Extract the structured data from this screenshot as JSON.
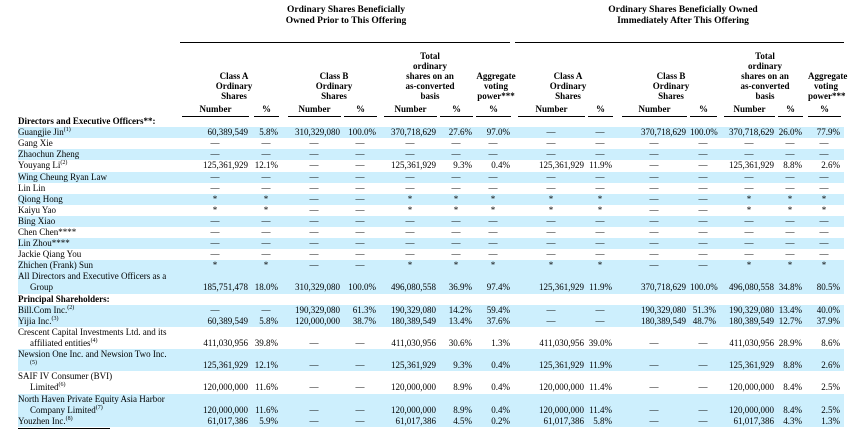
{
  "groups": [
    {
      "line1": "Ordinary Shares Beneficially",
      "line2": "Owned Prior to This Offering"
    },
    {
      "line1": "Ordinary Shares Beneficially Owned",
      "line2": "Immediately After This Offering"
    }
  ],
  "col_headers_prior": [
    {
      "lines": [
        "Class A",
        "Ordinary",
        "Shares"
      ]
    },
    {
      "lines": [
        "Class B",
        "Ordinary",
        "Shares"
      ]
    },
    {
      "lines": [
        "Total",
        "ordinary",
        "shares on an",
        "as-converted",
        "basis"
      ]
    },
    {
      "lines": [
        "Aggregate",
        "voting",
        "power***"
      ]
    }
  ],
  "col_headers_after": [
    {
      "lines": [
        "Class A",
        "Ordinary",
        "Shares"
      ]
    },
    {
      "lines": [
        "Class B",
        "Ordinary",
        "Shares"
      ]
    },
    {
      "lines": [
        "Total",
        "ordinary",
        "shares on an",
        "as-converted",
        "basis"
      ]
    },
    {
      "lines": [
        "Aggregate",
        "voting",
        "power***"
      ]
    }
  ],
  "subheaders": {
    "number": "Number",
    "pct": "%"
  },
  "section1": "Directors and Executive Officers**:",
  "section2": "Principal Shareholders:",
  "rows": [
    {
      "name": "Guangjie Jin",
      "sup": "(1)",
      "shade": true,
      "v": [
        "60,389,549",
        "5.8%",
        "310,329,080",
        "100.0%",
        "370,718,629",
        "27.6%",
        "97.0%",
        "—",
        "—",
        "370,718,629",
        "100.0%",
        "370,718,629",
        "26.0%",
        "77.9%"
      ]
    },
    {
      "name": "Gang Xie",
      "sup": "",
      "shade": false,
      "v": [
        "—",
        "—",
        "—",
        "—",
        "—",
        "—",
        "—",
        "—",
        "—",
        "—",
        "—",
        "—",
        "—",
        "—"
      ]
    },
    {
      "name": "Zhaochun Zheng",
      "sup": "",
      "shade": true,
      "v": [
        "—",
        "—",
        "—",
        "—",
        "—",
        "—",
        "—",
        "—",
        "—",
        "—",
        "—",
        "—",
        "—",
        "—"
      ]
    },
    {
      "name": "Youyang Li",
      "sup": "(2)",
      "shade": false,
      "v": [
        "125,361,929",
        "12.1%",
        "—",
        "—",
        "125,361,929",
        "9.3%",
        "0.4%",
        "125,361,929",
        "11.9%",
        "—",
        "—",
        "125,361,929",
        "8.8%",
        "2.6%"
      ]
    },
    {
      "name": "Wing Cheung Ryan Law",
      "sup": "",
      "shade": true,
      "v": [
        "—",
        "—",
        "—",
        "—",
        "—",
        "—",
        "—",
        "—",
        "—",
        "—",
        "—",
        "—",
        "—",
        "—"
      ]
    },
    {
      "name": "Lin Lin",
      "sup": "",
      "shade": false,
      "v": [
        "—",
        "—",
        "—",
        "—",
        "—",
        "—",
        "—",
        "—",
        "—",
        "—",
        "—",
        "—",
        "—",
        "—"
      ]
    },
    {
      "name": "Qiong Hong",
      "sup": "",
      "shade": true,
      "v": [
        "*",
        "*",
        "—",
        "—",
        "*",
        "*",
        "*",
        "*",
        "*",
        "—",
        "—",
        "*",
        "*",
        "*"
      ]
    },
    {
      "name": "Kaiyu Yao",
      "sup": "",
      "shade": false,
      "v": [
        "*",
        "*",
        "—",
        "—",
        "*",
        "*",
        "*",
        "*",
        "*",
        "—",
        "—",
        "*",
        "*",
        "*"
      ]
    },
    {
      "name": "Bing Xiao",
      "sup": "",
      "shade": true,
      "v": [
        "—",
        "—",
        "—",
        "—",
        "—",
        "—",
        "—",
        "—",
        "—",
        "—",
        "—",
        "—",
        "—",
        "—"
      ]
    },
    {
      "name": "Chen Chen****",
      "sup": "",
      "shade": false,
      "v": [
        "—",
        "—",
        "—",
        "—",
        "—",
        "—",
        "—",
        "—",
        "—",
        "—",
        "—",
        "—",
        "—",
        "—"
      ]
    },
    {
      "name": "Lin Zhou****",
      "sup": "",
      "shade": true,
      "v": [
        "—",
        "—",
        "—",
        "—",
        "—",
        "—",
        "—",
        "—",
        "—",
        "—",
        "—",
        "—",
        "—",
        "—"
      ]
    },
    {
      "name": "Jackie Qiang You",
      "sup": "",
      "shade": false,
      "v": [
        "—",
        "—",
        "—",
        "—",
        "—",
        "—",
        "—",
        "—",
        "—",
        "—",
        "—",
        "—",
        "—",
        "—"
      ]
    },
    {
      "name": "Zhichen (Frank) Sun",
      "sup": "",
      "shade": true,
      "v": [
        "*",
        "*",
        "—",
        "—",
        "*",
        "*",
        "*",
        "*",
        "*",
        "—",
        "—",
        "*",
        "*",
        "*"
      ]
    }
  ],
  "all_group": {
    "line1": "All Directors and Executive Officers as a",
    "line2": "Group",
    "v": [
      "185,751,478",
      "18.0%",
      "310,329,080",
      "100.0%",
      "496,080,558",
      "36.9%",
      "97.4%",
      "125,361,929",
      "11.9%",
      "370,718,629",
      "100.0%",
      "496,080,558",
      "34.8%",
      "80.5%"
    ]
  },
  "principal": [
    {
      "lines": [
        "Bill.Com Inc."
      ],
      "sup": "(2)",
      "shade": true,
      "v": [
        "—",
        "—",
        "190,329,080",
        "61.3%",
        "190,329,080",
        "14.2%",
        "59.4%",
        "—",
        "—",
        "190,329,080",
        "51.3%",
        "190,329,080",
        "13.4%",
        "40.0%"
      ]
    },
    {
      "lines": [
        "Yijia Inc."
      ],
      "sup": "(3)",
      "shade": true,
      "v": [
        "60,389,549",
        "5.8%",
        "120,000,000",
        "38.7%",
        "180,389,549",
        "13.4%",
        "37.6%",
        "—",
        "—",
        "180,389,549",
        "48.7%",
        "180,389,549",
        "12.7%",
        "37.9%"
      ]
    },
    {
      "lines": [
        "Crescent Capital Investments Ltd. and its",
        "affiliated entities"
      ],
      "sup": "(4)",
      "shade": false,
      "v": [
        "411,030,956",
        "39.8%",
        "—",
        "—",
        "411,030,956",
        "30.6%",
        "1.3%",
        "411,030,956",
        "39.0%",
        "—",
        "—",
        "411,030,956",
        "28.9%",
        "8.6%"
      ]
    },
    {
      "lines": [
        "Newsion One Inc. and Newsion Two Inc.",
        ""
      ],
      "sup": "(5)",
      "shade": true,
      "v": [
        "125,361,929",
        "12.1%",
        "—",
        "—",
        "125,361,929",
        "9.3%",
        "0.4%",
        "125,361,929",
        "11.9%",
        "—",
        "—",
        "125,361,929",
        "8.8%",
        "2.6%"
      ]
    },
    {
      "lines": [
        "SAIF IV Consumer (BVI)",
        "Limited"
      ],
      "sup": "(6)",
      "shade": false,
      "v": [
        "120,000,000",
        "11.6%",
        "—",
        "—",
        "120,000,000",
        "8.9%",
        "0.4%",
        "120,000,000",
        "11.4%",
        "—",
        "—",
        "120,000,000",
        "8.4%",
        "2.5%"
      ]
    },
    {
      "lines": [
        "North Haven Private Equity Asia Harbor",
        "Company Limited"
      ],
      "sup": "(7)",
      "shade": true,
      "v": [
        "120,000,000",
        "11.6%",
        "—",
        "—",
        "120,000,000",
        "8.9%",
        "0.4%",
        "120,000,000",
        "11.4%",
        "—",
        "—",
        "120,000,000",
        "8.4%",
        "2.5%"
      ]
    },
    {
      "lines": [
        "Youzhen Inc."
      ],
      "sup": "(8)",
      "shade": true,
      "v": [
        "61,017,386",
        "5.9%",
        "—",
        "—",
        "61,017,386",
        "4.5%",
        "0.2%",
        "61,017,386",
        "5.8%",
        "—",
        "—",
        "61,017,386",
        "4.3%",
        "1.3%"
      ]
    }
  ]
}
